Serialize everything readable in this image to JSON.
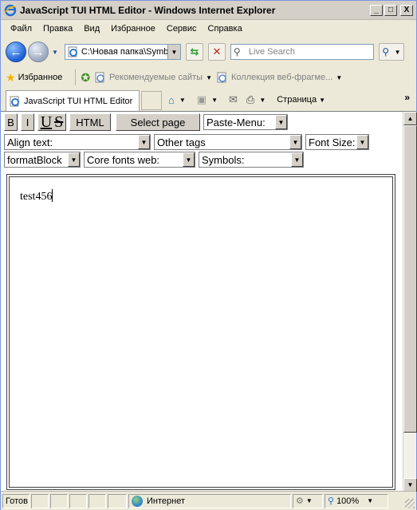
{
  "window": {
    "title": "JavaScript TUI HTML Editor - Windows Internet Explorer",
    "controls": {
      "minimize": "_",
      "maximize": "□",
      "close": "X"
    }
  },
  "menu": [
    "Файл",
    "Правка",
    "Вид",
    "Избранное",
    "Сервис",
    "Справка"
  ],
  "address": {
    "url": "C:\\Новая папка\\Symb",
    "search_placeholder": "Live Search"
  },
  "favorites": {
    "label": "Избранное",
    "links": [
      "Рекомендуемые сайты",
      "Коллекция веб-фрагме..."
    ]
  },
  "tabs": {
    "active": "JavaScript TUI HTML Editor",
    "page_menu": "Страница",
    "overflow": "»"
  },
  "editor_toolbar": {
    "bold": "B",
    "italic": "I",
    "underline": "U",
    "strike": "S",
    "html": "HTML",
    "select_page": "Select page",
    "paste_menu": "Paste-Menu:",
    "align_text": "Align text:",
    "other_tags": "Other tags",
    "font_size": "Font Size:",
    "format_block": "formatBlock",
    "core_fonts": "Core fonts web:",
    "symbols": "Symbols:"
  },
  "editor": {
    "text": "test456"
  },
  "status": {
    "left": "Готов",
    "zone": "Интернет",
    "zoom": "100%"
  },
  "colors": {
    "title_bar": "#d4d0c8",
    "chrome": "#ece9d8",
    "nav_back": "#1b5fd4"
  },
  "icons": [
    "ie-logo-icon",
    "back-arrow-icon",
    "forward-arrow-icon",
    "refresh-icon",
    "stop-icon",
    "search-icon",
    "star-icon",
    "add-favorite-icon",
    "home-icon",
    "rss-icon",
    "mail-icon",
    "print-icon",
    "globe-icon",
    "lock-icon",
    "zoom-icon"
  ]
}
